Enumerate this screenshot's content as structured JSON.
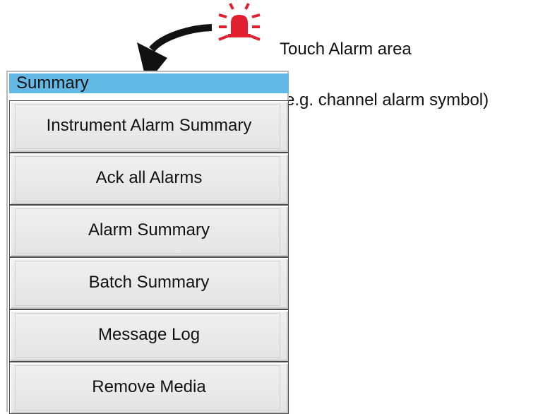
{
  "annotation": {
    "text_line_1": "Touch Alarm area",
    "text_line_2": "(e.g. channel alarm symbol)",
    "alarm_color": "#e02030"
  },
  "summary_menu": {
    "title": "Summary",
    "header_color": "#63b9e6",
    "items": [
      {
        "label": "Instrument Alarm Summary"
      },
      {
        "label": "Ack all Alarms"
      },
      {
        "label": "Alarm Summary"
      },
      {
        "label": "Batch Summary"
      },
      {
        "label": "Message Log"
      },
      {
        "label": "Remove Media"
      }
    ]
  }
}
